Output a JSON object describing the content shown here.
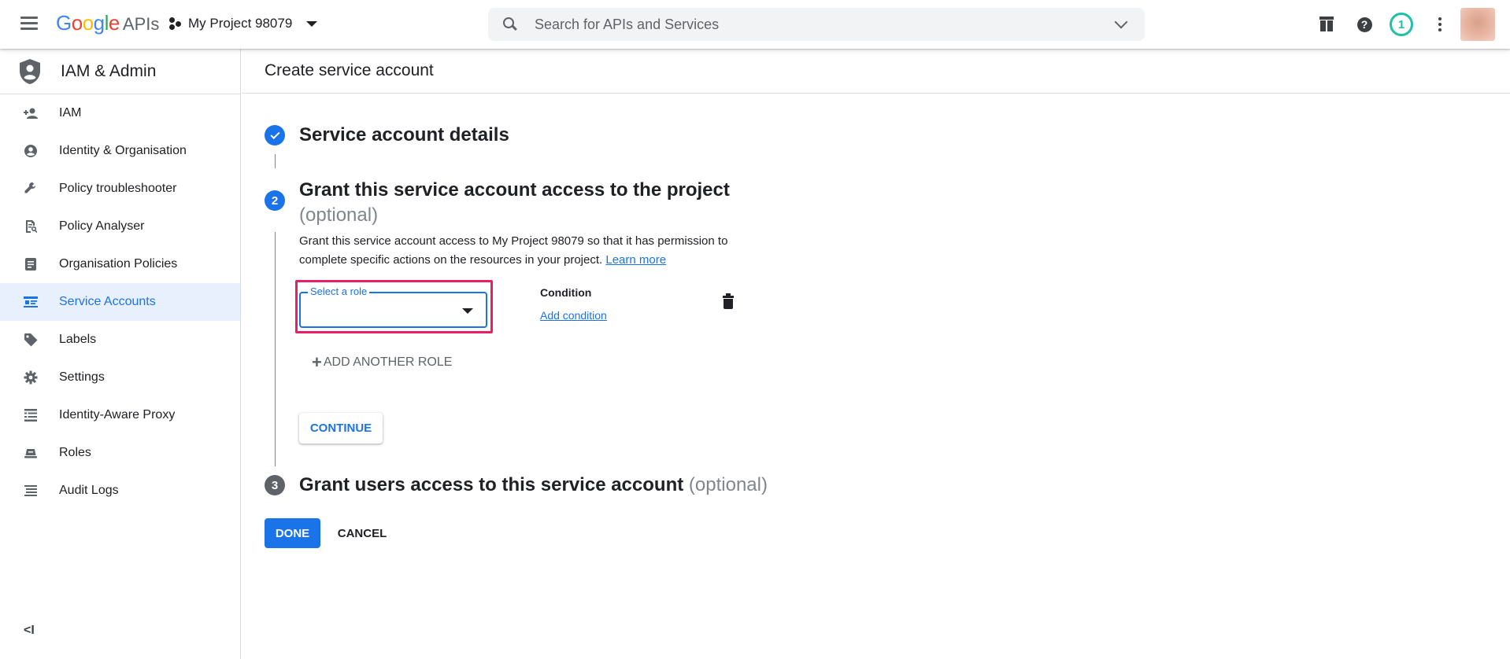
{
  "header": {
    "logo_letters": [
      "G",
      "o",
      "o",
      "g",
      "l",
      "e"
    ],
    "logo_suffix": "APIs",
    "project_name": "My Project 98079",
    "search_placeholder": "Search for APIs and Services",
    "notification_count": "1"
  },
  "sidebar": {
    "title": "IAM & Admin",
    "items": [
      {
        "label": "IAM",
        "icon": "person-add-icon"
      },
      {
        "label": "Identity & Organisation",
        "icon": "account-circle-icon"
      },
      {
        "label": "Policy troubleshooter",
        "icon": "wrench-icon"
      },
      {
        "label": "Policy Analyser",
        "icon": "policy-analyser-icon"
      },
      {
        "label": "Organisation Policies",
        "icon": "document-icon"
      },
      {
        "label": "Service Accounts",
        "icon": "service-account-icon",
        "active": true
      },
      {
        "label": "Labels",
        "icon": "label-icon"
      },
      {
        "label": "Settings",
        "icon": "gear-icon"
      },
      {
        "label": "Identity-Aware Proxy",
        "icon": "proxy-icon"
      },
      {
        "label": "Roles",
        "icon": "roles-icon"
      },
      {
        "label": "Audit Logs",
        "icon": "audit-list-icon"
      }
    ],
    "collapse_label": "<I"
  },
  "main": {
    "page_title": "Create service account",
    "step1": {
      "title": "Service account details"
    },
    "step2": {
      "number": "2",
      "title": "Grant this service account access to the project",
      "optional": "(optional)",
      "description": "Grant this service account access to My Project 98079 so that it has permission to complete specific actions on the resources in your project.",
      "learn_more": "Learn more",
      "role_label": "Select a role",
      "role_value": "",
      "condition_label": "Condition",
      "add_condition": "Add condition",
      "add_another_role": "ADD ANOTHER ROLE",
      "continue_label": "CONTINUE"
    },
    "step3": {
      "number": "3",
      "title": "Grant users access to this service account",
      "optional": "(optional)"
    },
    "done_label": "DONE",
    "cancel_label": "CANCEL"
  },
  "colors": {
    "accent": "#1a73e8",
    "highlight": "#e91e63",
    "notification": "#1ec1a5",
    "active_nav_bg": "#e8f0fe"
  }
}
